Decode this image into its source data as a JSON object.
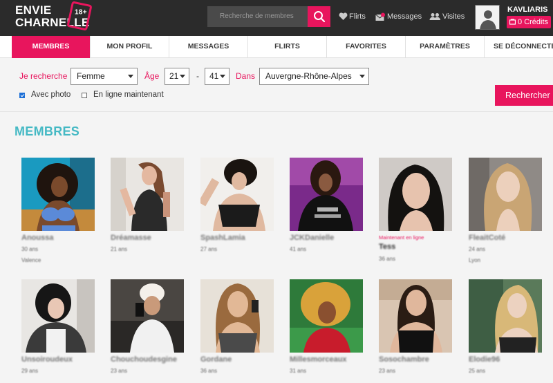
{
  "brand": {
    "line1": "ENVIE",
    "line2": "CHARNELLE",
    "badge": "18+"
  },
  "search": {
    "placeholder": "Recherche de membres"
  },
  "top_nav": {
    "flirts": "Flirts",
    "messages": "Messages",
    "visites": "Visites"
  },
  "user": {
    "name": "KAVLIARIS",
    "credits": "0 Crédits"
  },
  "tabs": [
    "MEMBRES",
    "MON PROFIL",
    "MESSAGES",
    "FLIRTS",
    "FAVORITES",
    "PARAMÈTRES",
    "SE DÉCONNECTER"
  ],
  "filters": {
    "seeking_label": "Je recherche",
    "seeking_value": "Femme",
    "age_label": "Âge",
    "age_min": "21",
    "age_separator": "-",
    "age_max": "41",
    "region_label": "Dans",
    "region_value": "Auvergne-Rhône-Alpes",
    "with_photo_label": "Avec photo",
    "with_photo_checked": true,
    "online_now_label": "En ligne maintenant",
    "online_now_checked": false,
    "submit_label": "Rechercher"
  },
  "section_title": "MEMBRES",
  "members": [
    {
      "name": "Anoussa",
      "age": "30 ans",
      "city": "Valence",
      "photo": "member-photo"
    },
    {
      "name": "Dréamasse",
      "age": "21 ans",
      "photo": "member-photo"
    },
    {
      "name": "SpashLamia",
      "age": "27 ans",
      "photo": "member-photo"
    },
    {
      "name": "JCKDanielle",
      "age": "41 ans",
      "photo": "member-photo"
    },
    {
      "name": "Tess",
      "status": "Maintenant en ligne",
      "age": "36 ans",
      "photo": "member-photo"
    },
    {
      "name": "FleaitCoté",
      "age": "24 ans",
      "city": "Lyon",
      "photo": "member-photo"
    },
    {
      "name": "Unsoiroudeux",
      "age": "29 ans",
      "photo": "member-photo"
    },
    {
      "name": "Chouchoudesgine",
      "age": "23 ans",
      "photo": "member-photo"
    },
    {
      "name": "Gordane",
      "age": "36 ans",
      "photo": "member-photo"
    },
    {
      "name": "Millesmorceaux",
      "age": "31 ans",
      "photo": "member-photo"
    },
    {
      "name": "Sosochambre",
      "age": "23 ans",
      "photo": "member-photo"
    },
    {
      "name": "Elodie96",
      "age": "25 ans",
      "photo": "member-photo"
    }
  ],
  "colors": {
    "accent": "#e8155d",
    "section_title": "#45b9c4",
    "topbar": "#2b2b2b"
  }
}
